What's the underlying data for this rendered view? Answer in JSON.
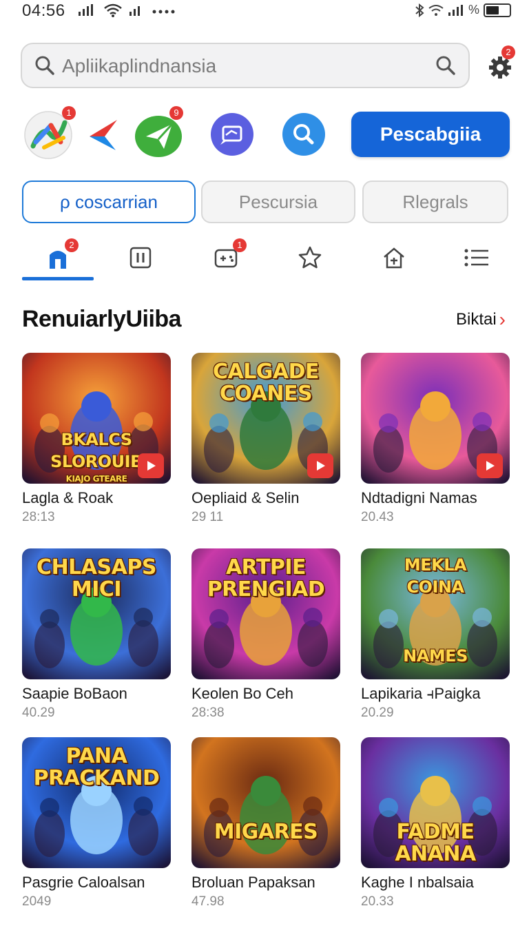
{
  "status_bar": {
    "time": "04:56",
    "right_text": "%"
  },
  "search": {
    "placeholder": "Apliikaplindnansia",
    "settings_badge": "2"
  },
  "apps": {
    "items": [
      {
        "name": "maps-app",
        "badge": "1"
      },
      {
        "name": "arrow-app",
        "badge": ""
      },
      {
        "name": "send-app",
        "badge": "9"
      },
      {
        "name": "messages-app",
        "badge": ""
      },
      {
        "name": "search-app",
        "badge": ""
      }
    ],
    "primary_button": "Pescabgiia"
  },
  "chips": [
    "ρ coscarrian",
    "Pescursia",
    "Rlegrals"
  ],
  "tabs": {
    "items": [
      {
        "icon": "home-icon",
        "badge": "2"
      },
      {
        "icon": "pause-icon",
        "badge": ""
      },
      {
        "icon": "gamepad-icon",
        "badge": "1"
      },
      {
        "icon": "star-icon",
        "badge": ""
      },
      {
        "icon": "house-icon",
        "badge": ""
      },
      {
        "icon": "list-icon",
        "badge": ""
      }
    ]
  },
  "section": {
    "title": "RenuiarlyUiiba",
    "more": "Biktai"
  },
  "games": [
    {
      "title": "Lagla & Roak",
      "sub": "28:13",
      "art_lines": [
        "BKALCS",
        "SLOROUIB",
        "KIAJO GTEARE"
      ],
      "corner_badge": true
    },
    {
      "title": "Oepliaid & Selin",
      "sub": "29 11",
      "art_lines": [
        "CALGADE",
        "COANES"
      ],
      "corner_badge": true
    },
    {
      "title": "Ndtadigni Namas",
      "sub": "20.43",
      "art_lines": [],
      "corner_badge": true
    },
    {
      "title": "Saapie BoBaon",
      "sub": "40.29",
      "art_lines": [
        "CHLASAPS",
        "MICI"
      ],
      "corner_badge": false
    },
    {
      "title": "Keolen Bo Ceh",
      "sub": "28:38",
      "art_lines": [
        "ARTPIE",
        "PRENGIAD"
      ],
      "corner_badge": false
    },
    {
      "title": "Lapikaria ⫞Paigka",
      "sub": "20.29",
      "art_lines": [
        "MEKLA",
        "COINA",
        "NAMES"
      ],
      "corner_badge": false
    },
    {
      "title": "Pasgrie Caloalsan",
      "sub": "2049",
      "art_lines": [
        "PANA",
        "PRACKAND"
      ],
      "corner_badge": false
    },
    {
      "title": "Broluan Papaksan",
      "sub": "47.98",
      "art_lines": [
        "MIGARES"
      ],
      "corner_badge": false
    },
    {
      "title": "Kaghe I nbalsaia",
      "sub": "20.33",
      "art_lines": [
        "FADME",
        "ANANA"
      ],
      "corner_badge": false
    }
  ],
  "colors": {
    "accent": "#1565d8",
    "badge": "#e53935",
    "thumb_palettes": [
      [
        "#f6a23a",
        "#c2361e",
        "#3a5bd8"
      ],
      [
        "#3f9ad6",
        "#d9a53a",
        "#2f7a3c"
      ],
      [
        "#7a2fb8",
        "#e85a9a",
        "#f2a93a"
      ],
      [
        "#1c2a5a",
        "#3c6fd8",
        "#32b84a"
      ],
      [
        "#5a1f8c",
        "#c93aa8",
        "#e8a23a"
      ],
      [
        "#79b7e0",
        "#4a8a3a",
        "#d9a24a"
      ],
      [
        "#122a6a",
        "#2f6be0",
        "#9ad2ff"
      ],
      [
        "#6a2a12",
        "#d2741f",
        "#3a8a3a"
      ],
      [
        "#3a9ae0",
        "#6a2fa0",
        "#e8c04a"
      ]
    ]
  }
}
